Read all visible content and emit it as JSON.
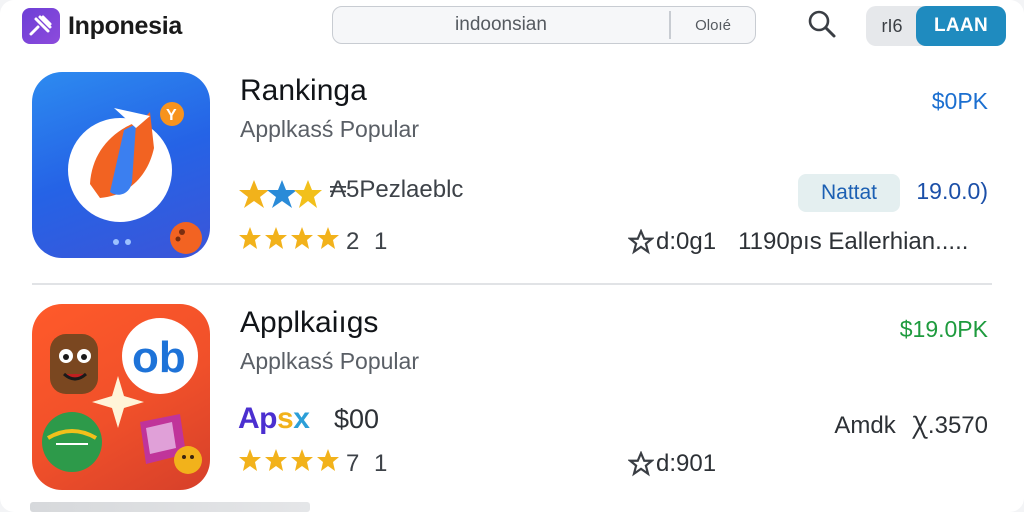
{
  "header": {
    "logo_text": "Inponesia",
    "search": {
      "value": "indoonsian",
      "tag": "Oloıé"
    },
    "toggle": {
      "off_label": "rI6",
      "on_label": "LAAN"
    }
  },
  "apps": [
    {
      "name": "Rankinga",
      "category": "Applkasś Popular",
      "price": "$0PK",
      "stat_line": "₳5Pezlaeblc",
      "chip_label": "Nattat",
      "chip_value": "19.0.0)",
      "rating_number": "2 1",
      "meta_left": "d:0g1",
      "meta_right": "1190pıs Eallerhian....."
    },
    {
      "name": "Applkaiıgs",
      "category": "Applkasś Popular",
      "price": "$19.0PK",
      "brand_word_a": "Ap",
      "brand_word_b": "s",
      "brand_word_c": "x",
      "brand_amount": "$00",
      "right_meta": "Amdk Ꭓ.3570",
      "rating_number": "7 1",
      "meta_left": "d:901"
    }
  ],
  "colors": {
    "accent": "#1f8bbf",
    "price_blue": "#1b6fd0",
    "price_green": "#1e9b3e",
    "star": "#f2b21b"
  }
}
